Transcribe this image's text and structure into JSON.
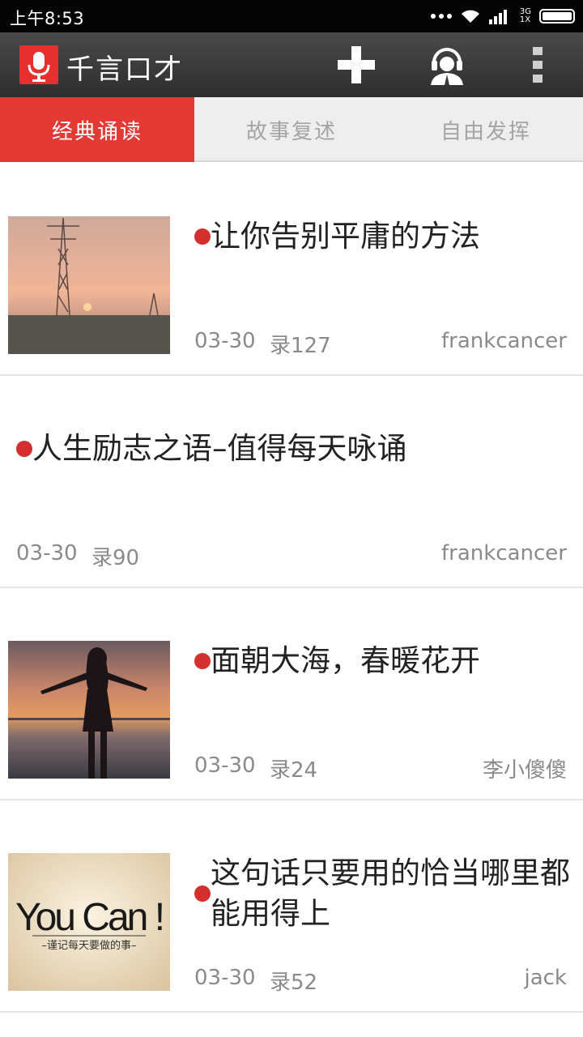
{
  "status_bar": {
    "time": "上午8:53",
    "network_label_top": "3G",
    "network_label_bottom": "1X"
  },
  "app_bar": {
    "title": "千言口才",
    "logo_icon": "microphone-icon",
    "actions": [
      "add-icon",
      "customer-service-icon",
      "overflow-menu-icon"
    ]
  },
  "tabs": [
    {
      "label": "经典诵读",
      "active": true
    },
    {
      "label": "故事复述",
      "active": false
    },
    {
      "label": "自由发挥",
      "active": false
    }
  ],
  "items": [
    {
      "title": "让你告别平庸的方法",
      "date": "03-30",
      "count": "录127",
      "author": "frankcancer",
      "thumbnail": "sunset-power-tower"
    },
    {
      "title": "人生励志之语–值得每天咏诵",
      "date": "03-30",
      "count": "录90",
      "author": "frankcancer"
    },
    {
      "title": "面朝大海，春暖花开",
      "date": "03-30",
      "count": "录24",
      "author": "李小傻傻",
      "thumbnail": "woman-at-sunset-beach"
    },
    {
      "title": "这句话只要用的恰当哪里都能用得上",
      "date": "03-30",
      "count": "录52",
      "author": "jack",
      "thumbnail": "you-can-poster",
      "thumb_text": "You Can !",
      "thumb_subtext": "–谨记每天要做的事–"
    }
  ],
  "colors": {
    "accent": "#e53935",
    "status_bar": "#050505",
    "app_bar": "#3a3a3a",
    "dot": "#d32f2f"
  }
}
